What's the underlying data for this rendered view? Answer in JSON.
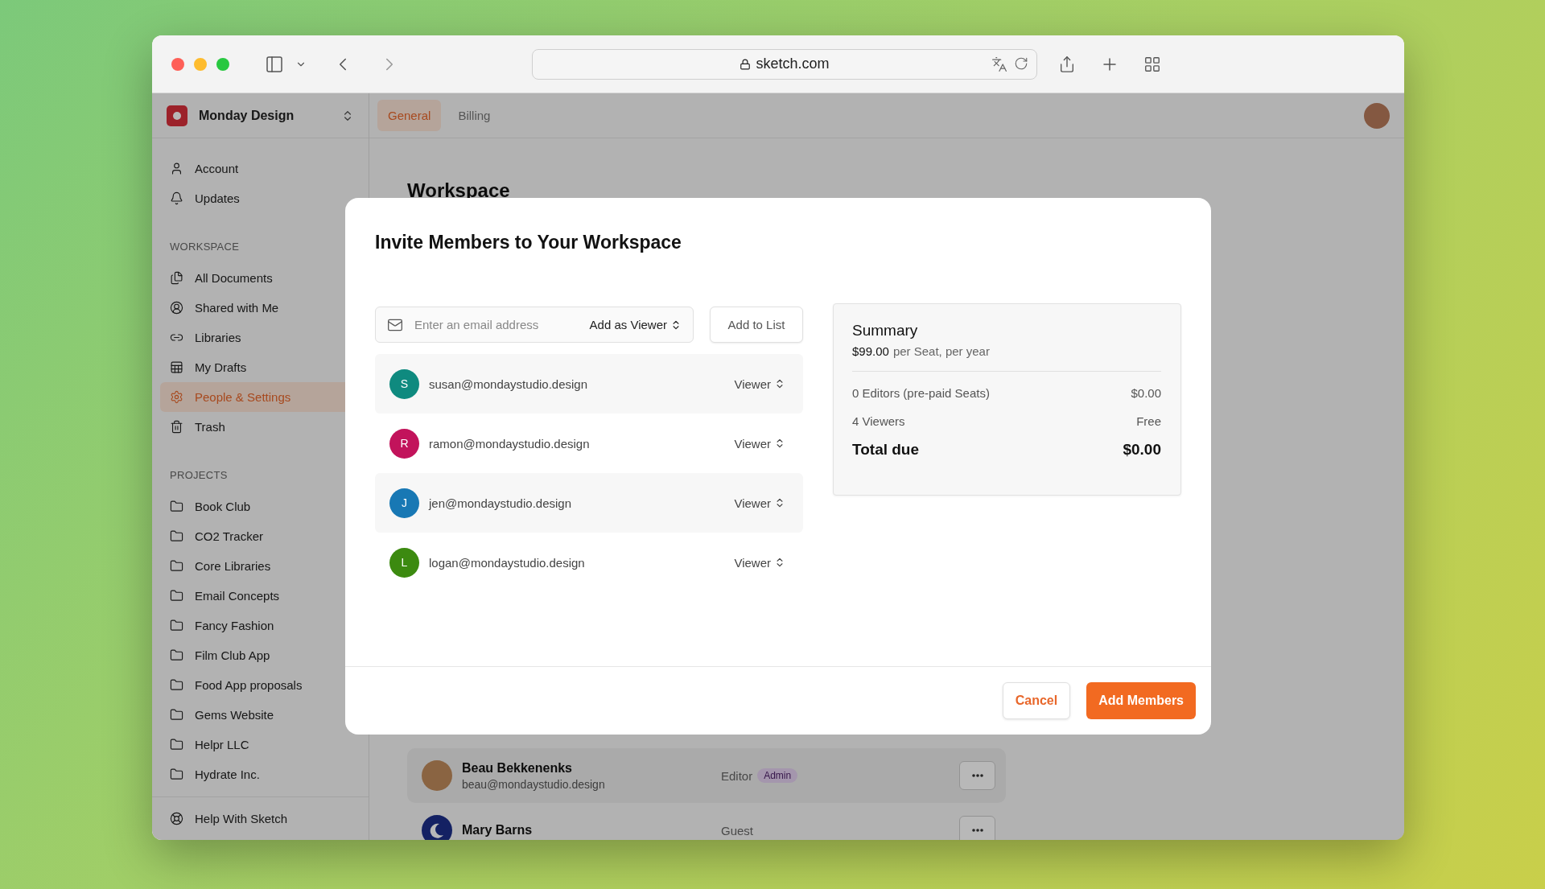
{
  "browser": {
    "url": "sketch.com"
  },
  "sidebar": {
    "workspace": "Monday Design",
    "top_items": [
      {
        "label": "Account",
        "selected": false
      },
      {
        "label": "Updates",
        "selected": false
      }
    ],
    "sections": [
      {
        "heading": "WORKSPACE",
        "items": [
          {
            "label": "All Documents",
            "selected": false
          },
          {
            "label": "Shared with Me",
            "selected": false
          },
          {
            "label": "Libraries",
            "selected": false
          },
          {
            "label": "My Drafts",
            "selected": false
          },
          {
            "label": "People & Settings",
            "selected": true
          },
          {
            "label": "Trash",
            "selected": false
          }
        ]
      },
      {
        "heading": "PROJECTS",
        "items": [
          {
            "label": "Book Club",
            "selected": false
          },
          {
            "label": "CO2 Tracker",
            "selected": false
          },
          {
            "label": "Core Libraries",
            "selected": false
          },
          {
            "label": "Email Concepts",
            "selected": false
          },
          {
            "label": "Fancy Fashion",
            "selected": false
          },
          {
            "label": "Film Club App",
            "selected": false
          },
          {
            "label": "Food App proposals",
            "selected": false
          },
          {
            "label": "Gems Website",
            "selected": false
          },
          {
            "label": "Helpr LLC",
            "selected": false
          },
          {
            "label": "Hydrate Inc.",
            "selected": false
          }
        ]
      }
    ],
    "footer_item": {
      "label": "Help With Sketch"
    }
  },
  "tabs": [
    {
      "label": "General",
      "selected": true
    },
    {
      "label": "Billing",
      "selected": false
    }
  ],
  "page": {
    "heading": "Workspace",
    "members": [
      {
        "name": "Beau Bekkenenks",
        "email": "beau@mondaystudio.design",
        "role": "Editor",
        "badge": "Admin"
      },
      {
        "name": "Mary Barns",
        "role": "Guest"
      }
    ]
  },
  "modal": {
    "title": "Invite Members to Your Workspace",
    "email_field": {
      "placeholder": "Enter an email address"
    },
    "role_select": "Add as Viewer",
    "add_button": "Add to List",
    "invitees": [
      {
        "initial": "S",
        "email": "susan@mondaystudio.design",
        "role": "Viewer",
        "color": "#0f8a7f"
      },
      {
        "initial": "R",
        "email": "ramon@mondaystudio.design",
        "role": "Viewer",
        "color": "#c2135b"
      },
      {
        "initial": "J",
        "email": "jen@mondaystudio.design",
        "role": "Viewer",
        "color": "#1878b4"
      },
      {
        "initial": "L",
        "email": "logan@mondaystudio.design",
        "role": "Viewer",
        "color": "#3c8a10"
      }
    ],
    "summary": {
      "title": "Summary",
      "price": "$99.00",
      "price_note": "per Seat, per year",
      "lines": [
        {
          "label": "0 Editors (pre-paid Seats)",
          "value": "$0.00"
        },
        {
          "label": "4 Viewers",
          "value": "Free"
        }
      ],
      "total_label": "Total due",
      "total_value": "$0.00"
    },
    "cancel_button": "Cancel",
    "primary_button": "Add Members"
  }
}
